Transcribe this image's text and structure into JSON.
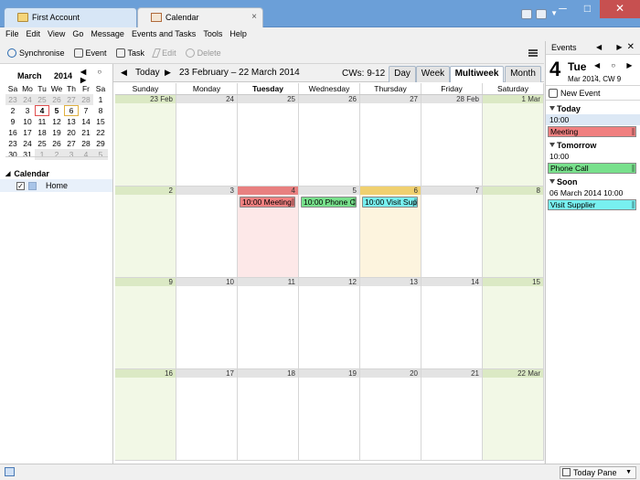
{
  "window": {
    "tabs": [
      {
        "label": "First Account"
      },
      {
        "label": "Calendar",
        "close": "×"
      }
    ],
    "controls": {
      "minimize": "─",
      "maximize": "□",
      "close": "✕"
    }
  },
  "menu": [
    "File",
    "Edit",
    "View",
    "Go",
    "Message",
    "Events and Tasks",
    "Tools",
    "Help"
  ],
  "toolbar": {
    "synchronise": "Synchronise",
    "event": "Event",
    "task": "Task",
    "edit": "Edit",
    "delete": "Delete"
  },
  "minimonth": {
    "month": "March",
    "year": "2014",
    "nav": "◀ ○ ▶",
    "weekdays": [
      "Sa",
      "Mo",
      "Tu",
      "We",
      "Th",
      "Fr",
      "Sa"
    ],
    "rows": [
      [
        "23",
        "24",
        "25",
        "26",
        "27",
        "28",
        "1"
      ],
      [
        "2",
        "3",
        "4",
        "5",
        "6",
        "7",
        "8"
      ],
      [
        "9",
        "10",
        "11",
        "12",
        "13",
        "14",
        "15"
      ],
      [
        "16",
        "17",
        "18",
        "19",
        "20",
        "21",
        "22"
      ],
      [
        "23",
        "24",
        "25",
        "26",
        "27",
        "28",
        "29"
      ],
      [
        "30",
        "31",
        "1",
        "2",
        "3",
        "4",
        "5"
      ]
    ]
  },
  "calendars": {
    "title": "Calendar",
    "items": [
      {
        "name": "Home",
        "checked": "✓"
      }
    ]
  },
  "nav": {
    "prev": "◀",
    "today": "Today",
    "next": "▶",
    "range": "23 February – 22 March 2014",
    "cws": "CWs: 9-12",
    "views": [
      "Day",
      "Week",
      "Multiweek",
      "Month"
    ]
  },
  "day_headers": [
    "Sunday",
    "Monday",
    "Tuesday",
    "Wednesday",
    "Thursday",
    "Friday",
    "Saturday"
  ],
  "weeks": [
    [
      "23 Feb",
      "24",
      "25",
      "26",
      "27",
      "28 Feb",
      "1 Mar"
    ],
    [
      "2",
      "3",
      "4",
      "5",
      "6",
      "7",
      "8"
    ],
    [
      "9",
      "10",
      "11",
      "12",
      "13",
      "14",
      "15"
    ],
    [
      "16",
      "17",
      "18",
      "19",
      "20",
      "21",
      "22 Mar"
    ]
  ],
  "events": [
    {
      "label": "10:00 Meeting",
      "color": "#f08080"
    },
    {
      "label": "10:00 Phone C...",
      "color": "#78e08c"
    },
    {
      "label": "10:00 Visit Sup...",
      "color": "#78f0f0"
    }
  ],
  "today_pane": {
    "title": "Events",
    "nav": "◀ ▶",
    "close": "✕",
    "day_number": "4",
    "day_name": "Tue",
    "sub": "Mar 2014, CW 9",
    "date_nav": "◀ ○ ▶ ,",
    "new_event": "New Event",
    "groups": [
      {
        "title": "Today",
        "time": "10:00",
        "event": "Meeting"
      },
      {
        "title": "Tomorrow",
        "time": "10:00",
        "event": "Phone Call"
      },
      {
        "title": "Soon",
        "time": "06 March 2014 10:00",
        "event": "Visit Supplier"
      }
    ]
  },
  "statusbar": {
    "today_pane": "Today Pane",
    "dropdown": "▼"
  },
  "colors": {
    "accent": "#6b9fd8",
    "today": "#e88080",
    "selected": "#f0d070",
    "weekend": "#f2f8e6"
  }
}
